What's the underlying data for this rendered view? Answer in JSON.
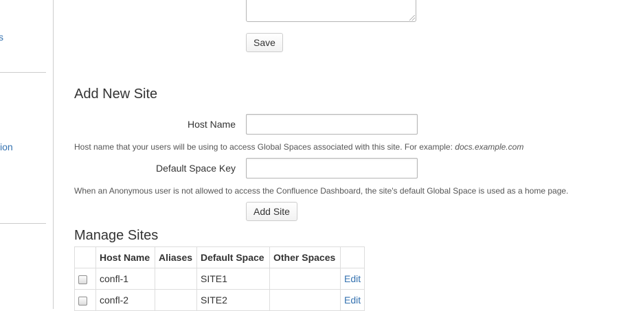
{
  "sidebar": {
    "link_top": "s",
    "link_middle": "ion"
  },
  "form_top": {
    "save_label": "Save"
  },
  "add_site": {
    "title": "Add New Site",
    "host_name_label": "Host Name",
    "host_name_value": "",
    "host_name_help_prefix": "Host name that your users will be using to access Global Spaces associated with this site. For example: ",
    "host_name_help_example": "docs.example.com",
    "space_key_label": "Default Space Key",
    "space_key_value": "",
    "space_key_help": "When an Anonymous user is not allowed to access the Confluence Dashboard, the site's default Global Space is used as a home page.",
    "add_button": "Add Site"
  },
  "manage_sites": {
    "title": "Manage Sites",
    "columns": [
      "",
      "Host Name",
      "Aliases",
      "Default Space",
      "Other Spaces",
      ""
    ],
    "rows": [
      {
        "host": "confl-1",
        "aliases": "",
        "default_space": "SITE1",
        "other_spaces": "",
        "action": "Edit"
      },
      {
        "host": "confl-2",
        "aliases": "",
        "default_space": "SITE2",
        "other_spaces": "",
        "action": "Edit"
      }
    ]
  },
  "colors": {
    "link": "#3572b0",
    "border": "#cccccc"
  }
}
